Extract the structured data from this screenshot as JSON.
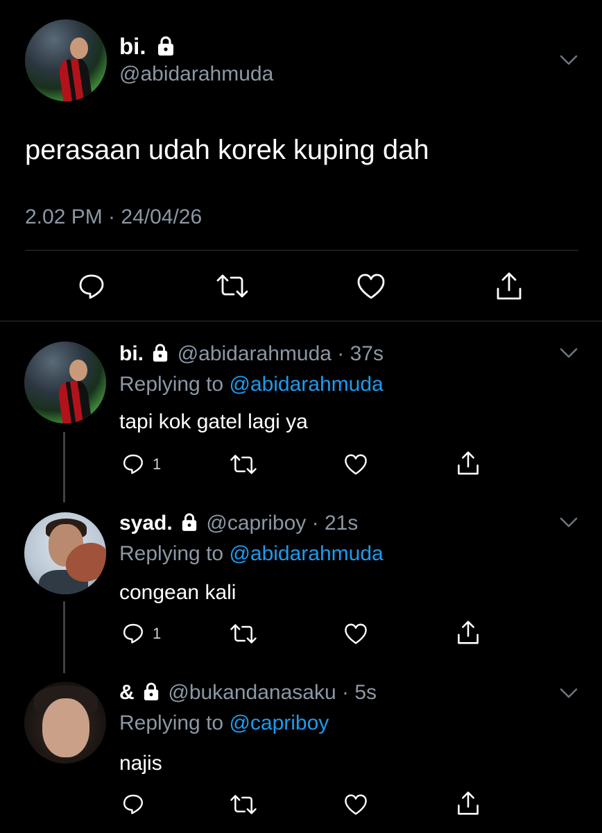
{
  "main_tweet": {
    "display_name": "bi.",
    "handle": "@abidarahmuda",
    "text": "perasaan udah korek kuping dah",
    "timestamp": "2.02 PM · 24/04/26",
    "icons": [
      "lock-icon",
      "chevron-down-icon",
      "reply-icon",
      "retweet-icon",
      "like-icon",
      "share-icon"
    ]
  },
  "replies": [
    {
      "display_name": "bi.",
      "handle": "@abidarahmuda",
      "time": "37s",
      "replying_label": "Replying to",
      "replying_to": "@abidarahmuda",
      "text": "tapi kok gatel lagi ya",
      "reply_count": "1"
    },
    {
      "display_name": "syad.",
      "handle": "@capriboy",
      "time": "21s",
      "replying_label": "Replying to",
      "replying_to": "@abidarahmuda",
      "text": "congean kali",
      "reply_count": "1"
    },
    {
      "display_name": "&",
      "handle": "@bukandanasaku",
      "time": "5s",
      "replying_label": "Replying to",
      "replying_to": "@capriboy",
      "text": "najis",
      "reply_count": ""
    }
  ],
  "colors": {
    "background": "#000000",
    "text": "#ffffff",
    "secondary": "#8b98a5",
    "link": "#1d9bf0",
    "divider": "#2f3336"
  }
}
